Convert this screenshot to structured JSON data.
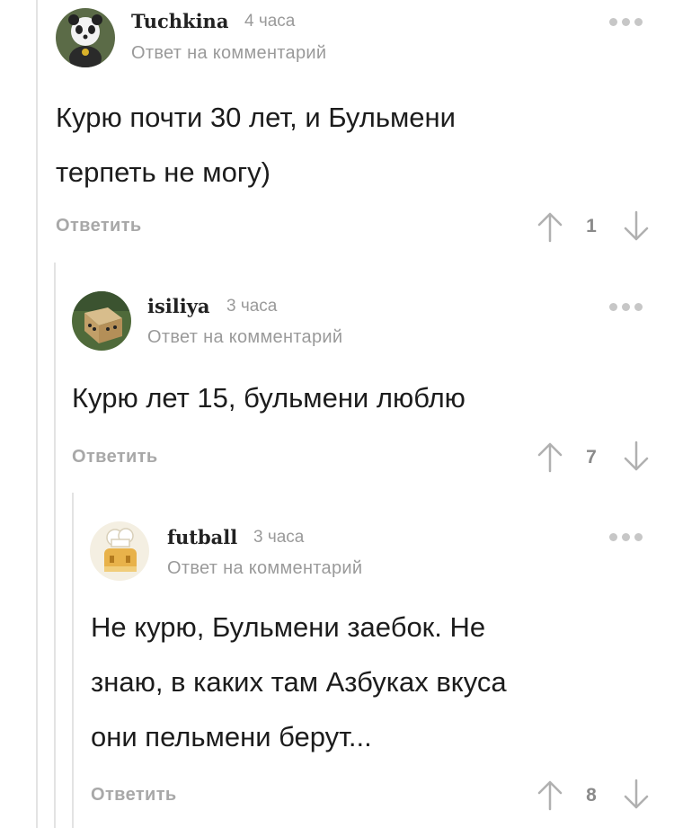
{
  "comments": [
    {
      "author": "Tuchkina",
      "time": "4 часа",
      "reply_to": "Ответ на комментарий",
      "text_lines": [
        "Курю почти 30 лет, и Бульмени",
        "терпеть не могу)"
      ],
      "reply_label": "Ответить",
      "score": "1",
      "avatar_icon": "panda-avatar-icon"
    },
    {
      "author": "isiliya",
      "time": "3 часа",
      "reply_to": "Ответ на комментарий",
      "text_lines": [
        "Курю лет 15, бульмени люблю"
      ],
      "reply_label": "Ответить",
      "score": "7",
      "avatar_icon": "box-avatar-icon"
    },
    {
      "author": "futball",
      "time": "3 часа",
      "reply_to": "Ответ на комментарий",
      "text_lines": [
        "Не курю, Бульмени заебок. Не",
        "знаю, в каких там Азбуках вкуса",
        "они пельмени берут..."
      ],
      "reply_label": "Ответить",
      "score": "8",
      "avatar_icon": "chef-avatar-icon"
    }
  ],
  "colors": {
    "muted_text": "#9a9a9a",
    "thread_line": "#e3e3e3",
    "arrow": "#b0b0b0"
  }
}
